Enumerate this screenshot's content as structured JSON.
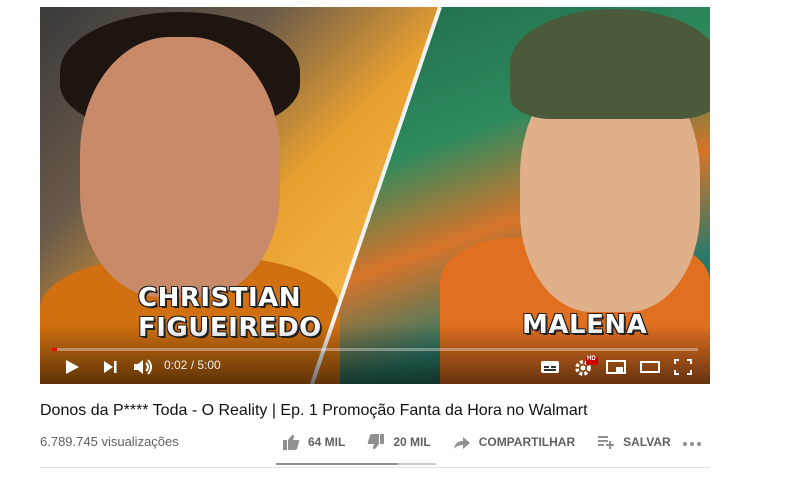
{
  "video": {
    "overlay_name_left_line1": "CHRISTIAN",
    "overlay_name_left_line2": "FIGUEIREDO",
    "overlay_name_right": "MALENA"
  },
  "player": {
    "time_current": "0:02",
    "time_total": "5:00",
    "time_display": "0:02 / 5:00",
    "progress_fraction": 0.007,
    "hd_badge": "HD",
    "accent_color": "#ff0000"
  },
  "info": {
    "title": "Donos da P**** Toda - O Reality | Ep. 1 Promoção Fanta da Hora no Walmart",
    "views": "6.789.745 visualizações",
    "likes": "64 MIL",
    "dislikes": "20 MIL",
    "share": "COMPARTILHAR",
    "save": "SALVAR",
    "like_ratio": 0.76
  },
  "icons": {
    "play": "play-icon",
    "next": "next-icon",
    "volume": "volume-icon",
    "subtitles": "subtitles-icon",
    "settings": "settings-icon",
    "miniplayer": "miniplayer-icon",
    "theater": "theater-icon",
    "fullscreen": "fullscreen-icon",
    "like": "thumbs-up-icon",
    "dislike": "thumbs-down-icon",
    "share": "share-icon",
    "save": "playlist-add-icon",
    "more": "more-dots-icon"
  }
}
